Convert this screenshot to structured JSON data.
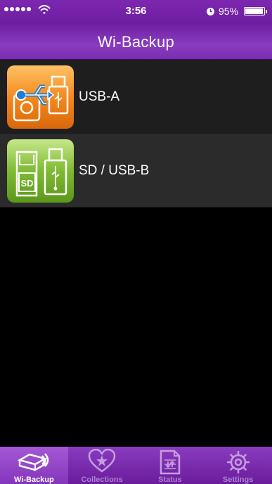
{
  "status_bar": {
    "time": "3:56",
    "battery_percent": "95%",
    "battery_level": 0.95,
    "signal_bars": 5
  },
  "nav": {
    "title": "Wi-Backup"
  },
  "list": {
    "items": [
      {
        "label": "USB-A",
        "icon": "usb-hdd-icon",
        "icon_color": "#f08a1c"
      },
      {
        "label": "SD / USB-B",
        "icon": "sd-usb-icon",
        "icon_color": "#7ab52e"
      }
    ]
  },
  "tab_bar": {
    "tabs": [
      {
        "label": "Wi-Backup",
        "icon": "wifi-backup-icon",
        "active": true
      },
      {
        "label": "Collections",
        "icon": "heart-star-icon",
        "active": false
      },
      {
        "label": "Status",
        "icon": "status-document-icon",
        "active": false
      },
      {
        "label": "Settings",
        "icon": "gear-icon",
        "active": false
      }
    ]
  },
  "colors": {
    "brand_purple": "#7d27b0",
    "background": "#000000",
    "active_tab": "#9a4ccc"
  }
}
